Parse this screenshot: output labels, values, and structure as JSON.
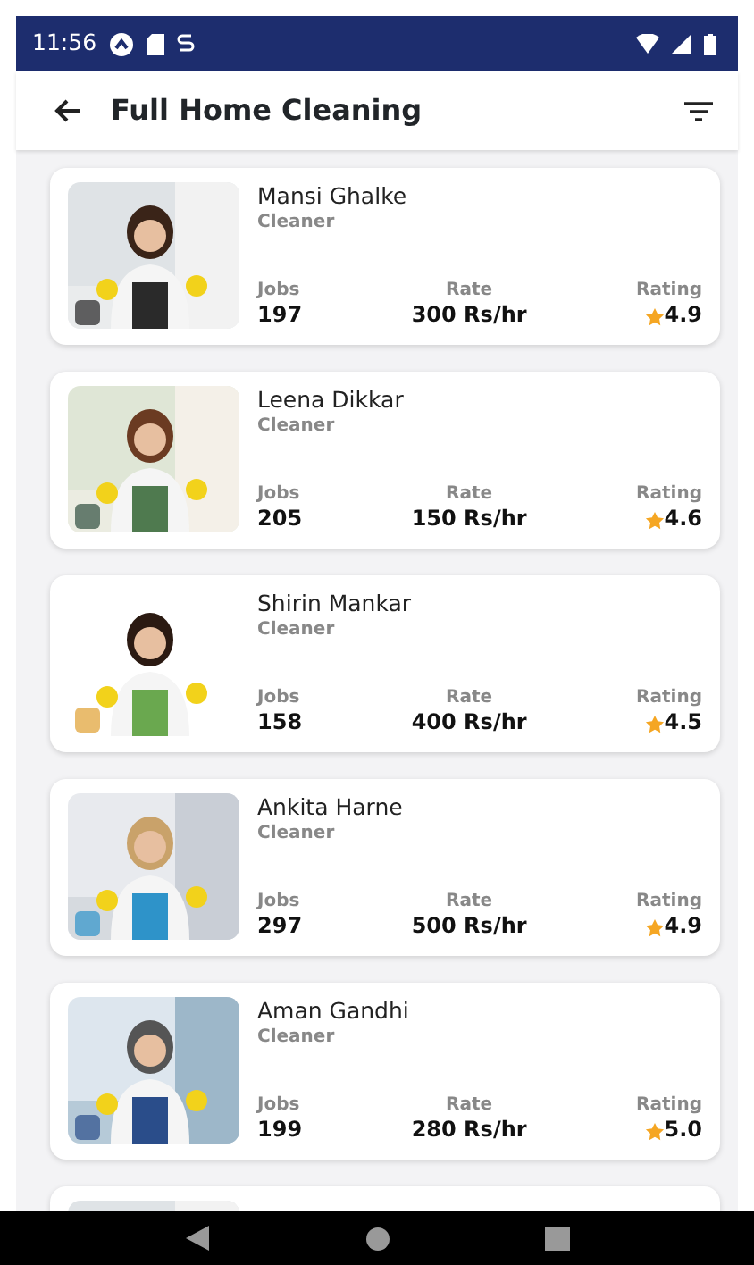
{
  "status_bar": {
    "time": "11:56"
  },
  "app_bar": {
    "title": "Full Home Cleaning"
  },
  "cleaners": [
    {
      "kind": "cleaner",
      "name": "Mansi Ghalke",
      "role": "Cleaner",
      "jobs_label": "Jobs",
      "jobs": "197",
      "rate_label": "Rate",
      "rate": "300 Rs/hr",
      "rating_label": "Rating",
      "rating": "4.9"
    },
    {
      "kind": "cleaner",
      "name": "Leena Dikkar",
      "role": "Cleaner",
      "jobs_label": "Jobs",
      "jobs": "205",
      "rate_label": "Rate",
      "rate": "150 Rs/hr",
      "rating_label": "Rating",
      "rating": "4.6"
    },
    {
      "kind": "cleaner",
      "name": "Shirin Mankar",
      "role": "Cleaner",
      "jobs_label": "Jobs",
      "jobs": "158",
      "rate_label": "Rate",
      "rate": "400 Rs/hr",
      "rating_label": "Rating",
      "rating": "4.5"
    },
    {
      "kind": "cleaner",
      "name": "Ankita Harne",
      "role": "Cleaner",
      "jobs_label": "Jobs",
      "jobs": "297",
      "rate_label": "Rate",
      "rate": "500 Rs/hr",
      "rating_label": "Rating",
      "rating": "4.9"
    },
    {
      "kind": "cleaner",
      "name": "Aman Gandhi",
      "role": "Cleaner",
      "jobs_label": "Jobs",
      "jobs": "199",
      "rate_label": "Rate",
      "rate": "280 Rs/hr",
      "rating_label": "Rating",
      "rating": "5.0"
    },
    {
      "kind": "picture"
    }
  ]
}
